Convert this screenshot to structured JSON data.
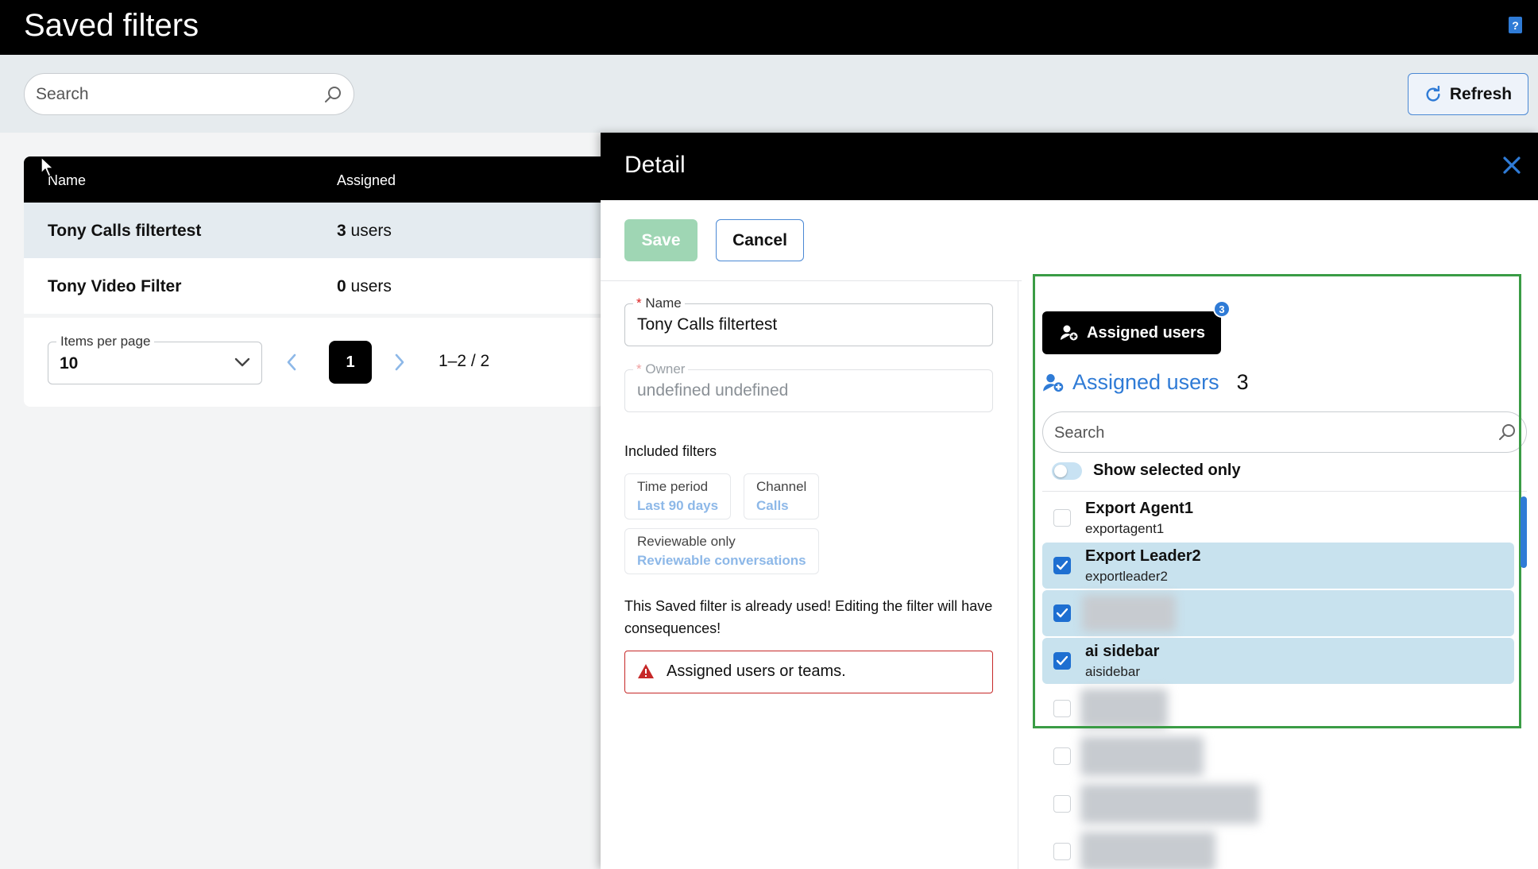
{
  "app": {
    "title": "Saved filters",
    "help_icon": "?"
  },
  "search": {
    "placeholder": "Search"
  },
  "toolbar": {
    "refresh_label": "Refresh"
  },
  "table": {
    "headers": {
      "name": "Name",
      "assigned": "Assigned"
    },
    "rows": [
      {
        "name": "Tony Calls filtertest",
        "count": "3",
        "unit": " users",
        "selected": true
      },
      {
        "name": "Tony Video Filter",
        "count": "0",
        "unit": " users",
        "selected": false
      }
    ]
  },
  "pagination": {
    "items_per_page_label": "Items per page",
    "items_per_page_value": "10",
    "current_page": "1",
    "range": "1–2 / 2"
  },
  "detail": {
    "title": "Detail",
    "save_label": "Save",
    "cancel_label": "Cancel",
    "name_field": {
      "required_mark": "*",
      "label": "Name",
      "value": "Tony Calls filtertest"
    },
    "owner_field": {
      "required_mark": "*",
      "label": "Owner",
      "value": "undefined undefined"
    },
    "included_filters_label": "Included filters",
    "filters": [
      {
        "key": "Time period",
        "value": "Last 90 days"
      },
      {
        "key": "Channel",
        "value": "Calls"
      },
      {
        "key": "Reviewable only",
        "value": "Reviewable conversations"
      }
    ],
    "warning_text": "This Saved filter is already used! Editing the filter will have consequences!",
    "error_text": "Assigned users or teams."
  },
  "users_panel": {
    "tab_label": "Assigned users",
    "tab_badge": "3",
    "heading": "Assigned users",
    "heading_count": "3",
    "search_placeholder": "Search",
    "toggle_label": "Show selected only",
    "users": [
      {
        "name": "Export Agent1",
        "username": "exportagent1",
        "checked": false
      },
      {
        "name": "Export Leader2",
        "username": "exportleader2",
        "checked": true
      },
      {
        "name": "",
        "username": "",
        "checked": true
      },
      {
        "name": "ai sidebar",
        "username": "aisidebar",
        "checked": true
      },
      {
        "name": "",
        "username": "",
        "checked": false
      },
      {
        "name": "",
        "username": "",
        "checked": false
      },
      {
        "name": "",
        "username": "",
        "checked": false
      },
      {
        "name": "",
        "username": "",
        "checked": false
      }
    ]
  },
  "colors": {
    "accent": "#2f7bd6",
    "selected_row": "#c8e2ee",
    "save_disabled": "#9fd6b4",
    "error": "#c62828",
    "highlight_box": "#3a9c45"
  }
}
